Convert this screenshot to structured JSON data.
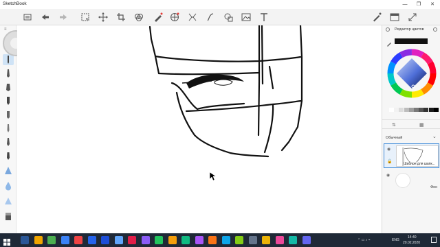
{
  "window": {
    "title": "SketchBook",
    "minimize_glyph": "—",
    "restore_glyph": "❐",
    "close_glyph": "✕"
  },
  "toolbar": {
    "icons": [
      "gallery-icon",
      "undo-icon",
      "redo-icon",
      "select-icon",
      "move-transform-icon",
      "crop-icon",
      "symmetry-icon",
      "brush-icon",
      "grid-icon",
      "perspective-icon",
      "curve-icon",
      "fill-icon",
      "image-icon",
      "text-icon",
      "pen-icon",
      "window-icon",
      "fullscreen-icon"
    ]
  },
  "left_tools": [
    "lasso-icon",
    "pencil-icon",
    "ballpoint-icon",
    "marker-icon",
    "brush-icon",
    "felt-pen-icon",
    "airbrush-icon",
    "ink-pen-icon",
    "smudge-icon",
    "blur-icon",
    "triangle-brush-icon",
    "water-drop-icon",
    "triangle-icon",
    "eraser-icon"
  ],
  "color_panel": {
    "title": "Редактор цветов",
    "current_color": "#111111",
    "palette": [
      "#ffffff",
      "#f2f2f2",
      "#dcdcdc",
      "#bdbdbd",
      "#9e9e9e",
      "#7a7a7a",
      "#555555",
      "#333333",
      "#1a1a1a",
      "#000000"
    ]
  },
  "layers": {
    "blend_mode": "Обычный",
    "items": [
      {
        "name": "Шаблон для шапк...",
        "selected": true
      },
      {
        "name": "Фон",
        "selected": false
      }
    ]
  },
  "taskbar": {
    "language": "ENG",
    "time": "14:40",
    "date": "20.02.2020",
    "app_colors": [
      "#2b5797",
      "#f0a500",
      "#4caf50",
      "#3b82f6",
      "#ef4444",
      "#2563eb",
      "#1d4ed8",
      "#60a5fa",
      "#e11d48",
      "#8b5cf6",
      "#22c55e",
      "#f59e0b",
      "#10b981",
      "#a855f7",
      "#f97316",
      "#0ea5e9",
      "#84cc16",
      "#64748b",
      "#eab308",
      "#ec4899",
      "#14b8a6",
      "#6366f1"
    ]
  }
}
